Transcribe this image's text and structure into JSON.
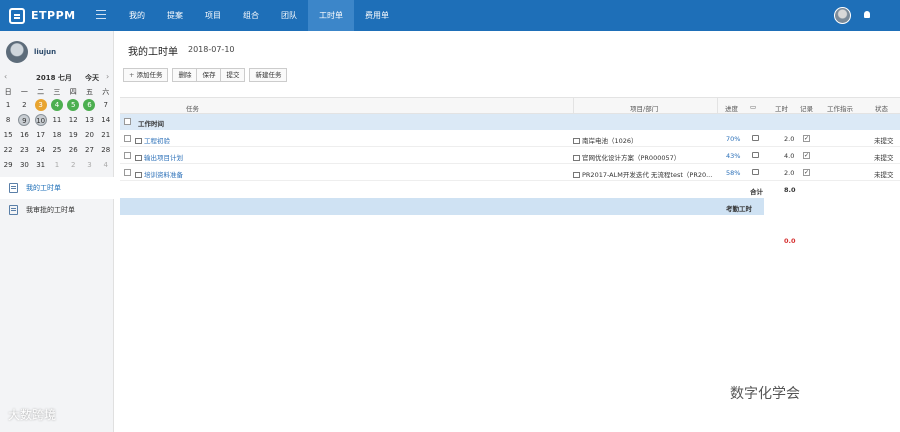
{
  "app": {
    "name": "ETPPM"
  },
  "nav": [
    {
      "label": "我的"
    },
    {
      "label": "提案"
    },
    {
      "label": "项目"
    },
    {
      "label": "组合"
    },
    {
      "label": "团队"
    },
    {
      "label": "工时单",
      "active": true
    },
    {
      "label": "费用单"
    }
  ],
  "user": {
    "name": "liujun"
  },
  "calendar": {
    "year_month": "2018 七月",
    "today_label": "今天",
    "prev": "‹",
    "next": "›",
    "weekdays": [
      "日",
      "一",
      "二",
      "三",
      "四",
      "五",
      "六"
    ],
    "rows": [
      [
        "1",
        "2",
        "3",
        "4",
        "5",
        "6",
        "7"
      ],
      [
        "8",
        "9",
        "10",
        "11",
        "12",
        "13",
        "14"
      ],
      [
        "15",
        "16",
        "17",
        "18",
        "19",
        "20",
        "21"
      ],
      [
        "22",
        "23",
        "24",
        "25",
        "26",
        "27",
        "28"
      ],
      [
        "29",
        "30",
        "31",
        "1",
        "2",
        "3",
        "4"
      ]
    ]
  },
  "sidebar": {
    "items": [
      {
        "label": "我的工时单",
        "active": true
      },
      {
        "label": "我审批的工时单"
      }
    ]
  },
  "page": {
    "title": "我的工时单",
    "date": "2018-07-10"
  },
  "toolbar": {
    "add_task": "添加任务",
    "delete": "删除",
    "save": "保存",
    "submit": "提交",
    "new_task": "新建任务"
  },
  "table": {
    "headers": {
      "task": "任务",
      "project": "项目/部门",
      "progress": "进度",
      "hours": "工时",
      "record": "记录",
      "log": "工作指示",
      "status": "状态"
    },
    "group_label": "工作时间",
    "rows": [
      {
        "task": "工程初验",
        "project": "南岸电池（1026）",
        "progress": "70%",
        "hours": "2.0",
        "status": "未提交"
      },
      {
        "task": "输出项目计划",
        "project": "官网优化设计方案（PR000057）",
        "progress": "43%",
        "hours": "4.0",
        "status": "未提交"
      },
      {
        "task": "培训资料准备",
        "project": "PR2017-ALM开发迭代 无流程test（PR20...",
        "progress": "58%",
        "hours": "2.0",
        "status": "未提交"
      }
    ],
    "total_label": "合计",
    "total_value": "8.0",
    "attendance_label": "考勤工时",
    "attendance_value": "0.0"
  },
  "watermarks": {
    "left": "大数跨境",
    "right": "数字化学会"
  }
}
